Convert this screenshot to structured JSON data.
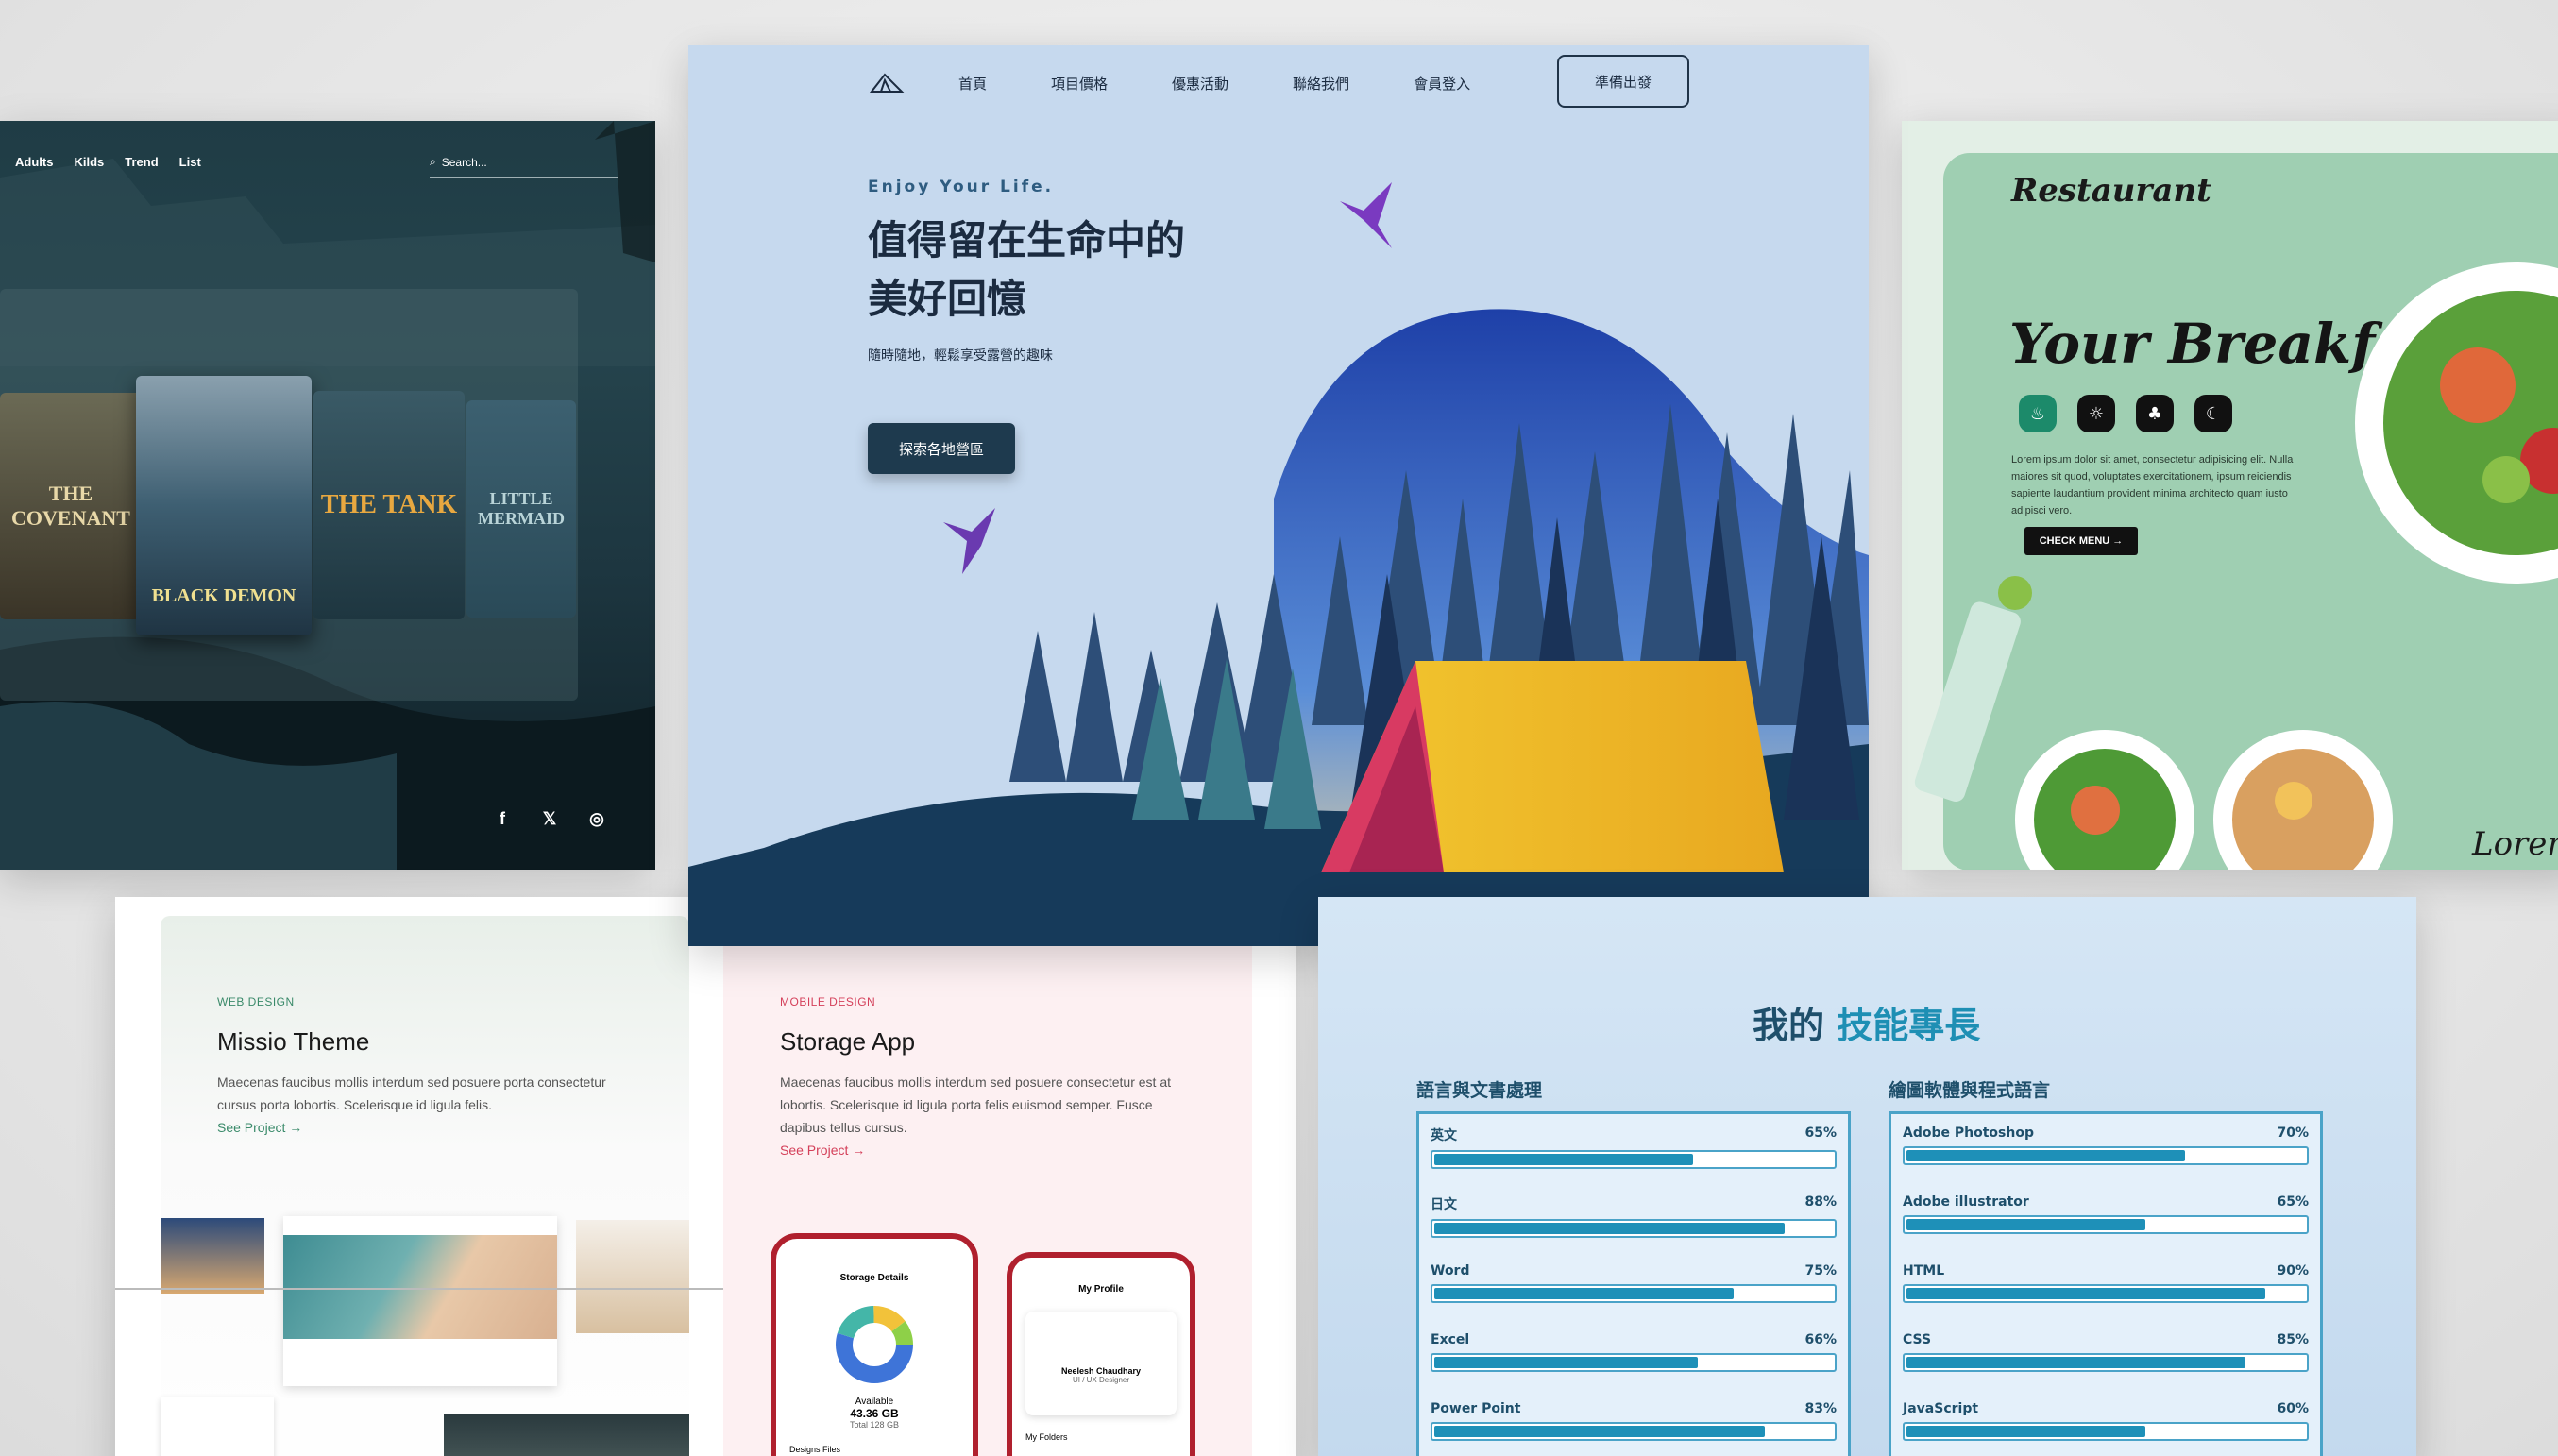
{
  "movie": {
    "nav": [
      "Adults",
      "Kilds",
      "Trend",
      "List"
    ],
    "search_placeholder": "Search...",
    "posters": [
      "THE COVENANT",
      "BLACK DEMON",
      "THE TANK",
      "LITTLE MERMAID"
    ],
    "social": [
      "facebook-icon",
      "x-icon",
      "instagram-icon"
    ]
  },
  "camp": {
    "nav": [
      "首頁",
      "項目價格",
      "優惠活動",
      "聯絡我們",
      "會員登入"
    ],
    "cta": "準備出發",
    "tagline": "Enjoy Your Life.",
    "title_line1": "值得留在生命中的",
    "title_line2": "美好回憶",
    "subtitle": "隨時隨地，輕鬆享受露營的趣味",
    "button": "探索各地營區"
  },
  "restaurant": {
    "logo": "Restaurant",
    "title": "Your Breakfast",
    "text": "Lorem ipsum dolor sit amet, consectetur adipisicing elit. Nulla maiores sit quod, voluptates exercitationem, ipsum reiciendis sapiente laudantium provident minima architecto quam iusto adipisci vero.",
    "button": "CHECK MENU →",
    "lorem": "Lorem"
  },
  "portfolio": {
    "cards": [
      {
        "category": "WEB DESIGN",
        "name": "Missio Theme",
        "desc": "Maecenas faucibus mollis interdum sed posuere porta consectetur cursus porta lobortis. Scelerisque id ligula felis.",
        "link": "See Project →",
        "accent": "#3a8a6a"
      },
      {
        "category": "MOBILE DESIGN",
        "name": "Storage App",
        "desc": "Maecenas faucibus mollis interdum sed posuere consectetur est at lobortis. Scelerisque id ligula porta felis euismod semper. Fusce dapibus tellus cursus.",
        "link": "See Project →",
        "accent": "#d4405a"
      }
    ],
    "phone1": {
      "title": "Storage Details",
      "available": "Available",
      "size": "43.36 GB",
      "total": "Total 128 GB",
      "files": "Designs Files"
    },
    "phone2": {
      "title": "My Profile",
      "name": "Neelesh Chaudhary",
      "role": "UI / UX Designer",
      "folders": "My Folders"
    }
  },
  "skills": {
    "title_a": "我的",
    "title_b": "技能專長",
    "col1_title": "語言與文書處理",
    "col2_title": "繪圖軟體與程式語言",
    "col1": [
      {
        "name": "英文",
        "pct": "65%",
        "v": 65
      },
      {
        "name": "日文",
        "pct": "88%",
        "v": 88
      },
      {
        "name": "Word",
        "pct": "75%",
        "v": 75
      },
      {
        "name": "Excel",
        "pct": "66%",
        "v": 66
      },
      {
        "name": "Power Point",
        "pct": "83%",
        "v": 83
      }
    ],
    "col2": [
      {
        "name": "Adobe Photoshop",
        "pct": "70%",
        "v": 70
      },
      {
        "name": "Adobe illustrator",
        "pct": "65%",
        "v": 60
      },
      {
        "name": "HTML",
        "pct": "90%",
        "v": 90
      },
      {
        "name": "CSS",
        "pct": "85%",
        "v": 85
      },
      {
        "name": "JavaScript",
        "pct": "60%",
        "v": 60
      }
    ]
  }
}
